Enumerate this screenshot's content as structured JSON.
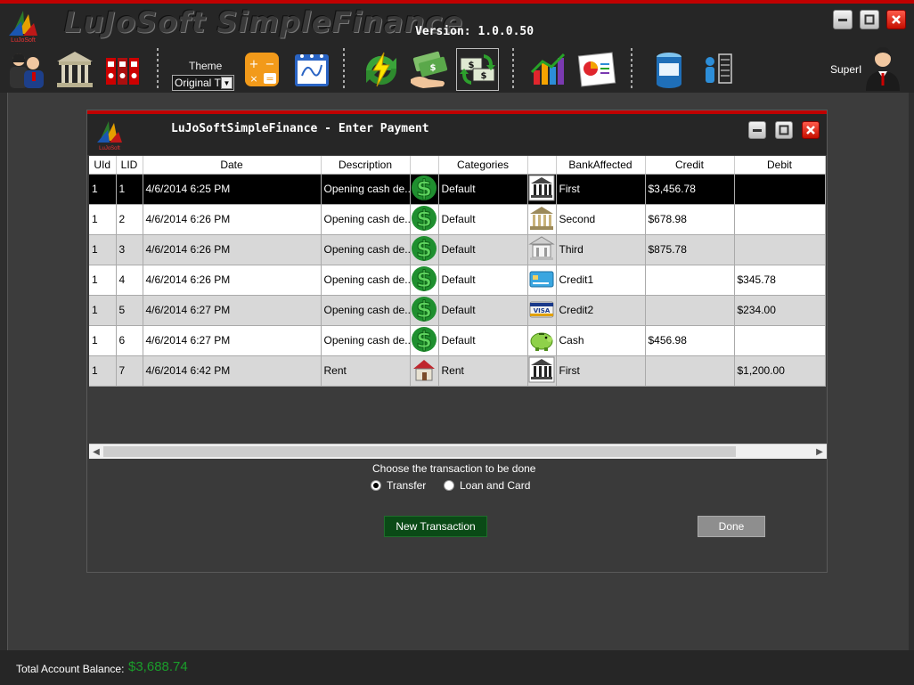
{
  "window": {
    "title": "LuJoSoft SimpleFinance",
    "version": "Version: 1.0.0.50",
    "logo_text": "LuJoSoft"
  },
  "toolbar": {
    "theme_label": "Theme",
    "theme_value": "Original Th",
    "user_name": "SuperI",
    "icons": [
      "users-icon",
      "bank-icon",
      "binders-icon",
      "calculator-icon",
      "calendar-icon",
      "transfer-icon",
      "payment-icon",
      "money-exchange-icon",
      "chart-icon",
      "report-icon",
      "database-icon",
      "admin-icon"
    ]
  },
  "dialog": {
    "title": "LuJoSoftSimpleFinance - Enter Payment",
    "columns": [
      "UId",
      "LID",
      "Date",
      "Description",
      "",
      "Categories",
      "",
      "BankAffected",
      "Credit",
      "Debit"
    ],
    "rows": [
      {
        "uid": "1",
        "lid": "1",
        "date": "4/6/2014 6:25 PM",
        "description": "Opening cash de...",
        "cat_icon": "dollar-icon",
        "category": "Default",
        "bank_icon": "bank-building-icon",
        "bank": "First",
        "credit": "$3,456.78",
        "debit": ""
      },
      {
        "uid": "1",
        "lid": "2",
        "date": "4/6/2014 6:26 PM",
        "description": "Opening cash de...",
        "cat_icon": "dollar-icon",
        "category": "Default",
        "bank_icon": "bank-gold-icon",
        "bank": "Second",
        "credit": "$678.98",
        "debit": ""
      },
      {
        "uid": "1",
        "lid": "3",
        "date": "4/6/2014 6:26 PM",
        "description": "Opening cash de...",
        "cat_icon": "dollar-icon",
        "category": "Default",
        "bank_icon": "bank-white-icon",
        "bank": "Third",
        "credit": "$875.78",
        "debit": ""
      },
      {
        "uid": "1",
        "lid": "4",
        "date": "4/6/2014 6:26 PM",
        "description": "Opening cash de...",
        "cat_icon": "dollar-icon",
        "category": "Default",
        "bank_icon": "credit-card-icon",
        "bank": "Credit1",
        "credit": "",
        "debit": "$345.78"
      },
      {
        "uid": "1",
        "lid": "5",
        "date": "4/6/2014 6:27 PM",
        "description": "Opening cash de...",
        "cat_icon": "dollar-icon",
        "category": "Default",
        "bank_icon": "visa-card-icon",
        "bank": "Credit2",
        "credit": "",
        "debit": "$234.00"
      },
      {
        "uid": "1",
        "lid": "6",
        "date": "4/6/2014 6:27 PM",
        "description": "Opening cash de...",
        "cat_icon": "dollar-icon",
        "category": "Default",
        "bank_icon": "piggy-bank-icon",
        "bank": "Cash",
        "credit": "$456.98",
        "debit": ""
      },
      {
        "uid": "1",
        "lid": "7",
        "date": "4/6/2014 6:42 PM",
        "description": "Rent",
        "cat_icon": "house-icon",
        "category": "Rent",
        "bank_icon": "bank-building-icon",
        "bank": "First",
        "credit": "",
        "debit": "$1,200.00"
      }
    ],
    "choose_label": "Choose the transaction to be done",
    "radio_transfer": "Transfer",
    "radio_loan": "Loan and Card",
    "new_transaction": "New Transaction",
    "done": "Done"
  },
  "status": {
    "total_label": "Total Account Balance:",
    "total_value": "$3,688.74"
  },
  "colors": {
    "accent_red": "#c00000",
    "balance_green": "#1a9d2a",
    "new_btn_green": "#0a4a16"
  }
}
